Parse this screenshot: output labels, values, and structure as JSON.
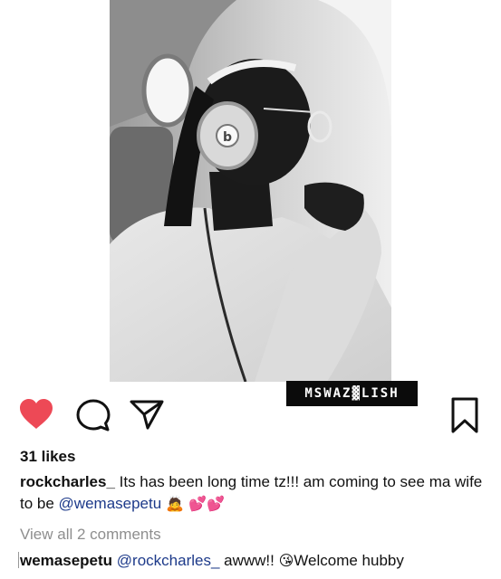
{
  "post": {
    "watermark": "MSWAZ▓LISH",
    "icons": {
      "like": "heart-filled-icon",
      "comment": "comment-bubble-icon",
      "share": "paper-plane-icon",
      "save": "bookmark-icon"
    },
    "colors": {
      "like": "#ed4956",
      "mention": "#1d3a8a",
      "muted": "#8e8e8e"
    },
    "likes": "31 likes",
    "caption": {
      "username": "rockcharles_",
      "text": " Its has been long time tz!!! am coming to see ma wife to be ",
      "mention": "@wemasepetu",
      "emojis": " 🙇 💕💕"
    },
    "view_all_comments": "View all 2 comments",
    "comment": {
      "username": "wemasepetu",
      "mention": "@rockcharles_",
      "text": " awww!! ",
      "emoji": "😘",
      "text_after": "Welcome hubby"
    }
  }
}
